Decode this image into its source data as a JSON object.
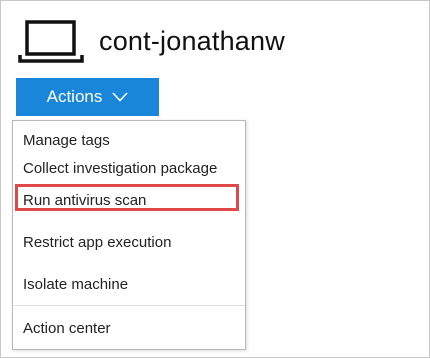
{
  "header": {
    "machine_name": "cont-jonathanw",
    "icon": "laptop-icon"
  },
  "actions": {
    "label": "Actions",
    "icon": "chevron-down-icon",
    "color": "#1a86d9"
  },
  "menu": {
    "items": [
      {
        "label": "Manage tags"
      },
      {
        "label": "Collect investigation package"
      },
      {
        "label": "Run antivirus scan",
        "highlighted": true
      },
      {
        "label": "Restrict app execution"
      },
      {
        "label": "Isolate machine"
      },
      {
        "label": "Action center"
      }
    ],
    "highlight_color": "#e0494a"
  }
}
